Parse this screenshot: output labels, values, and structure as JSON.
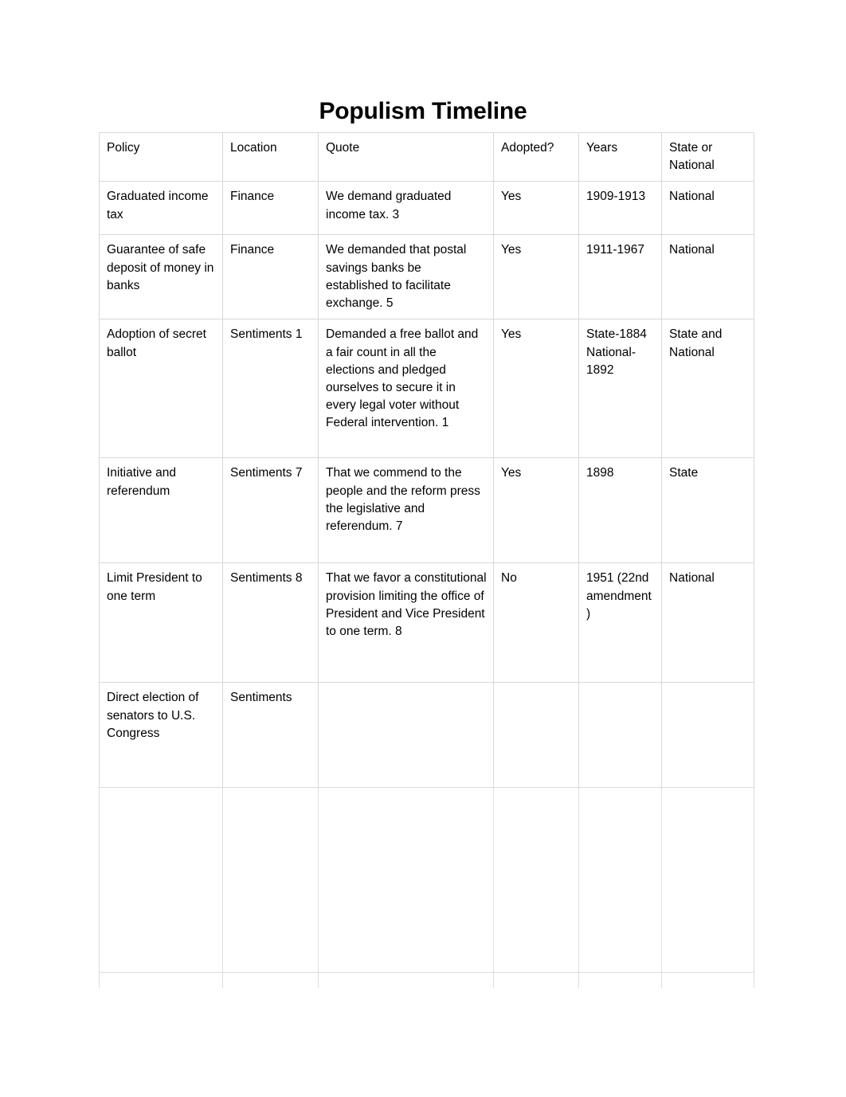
{
  "document": {
    "title": "Populism Timeline",
    "background_color": "#ffffff",
    "text_color": "#000000",
    "grid_color": "#d8d8d8"
  },
  "table": {
    "name": "populism-timeline-table",
    "columns": [
      "Policy",
      "Location",
      "Quote",
      "Adopted?",
      "Years",
      "State or National"
    ],
    "rows": [
      {
        "policy": "Graduated income tax",
        "location": "Finance",
        "quote": "We demand graduated income tax. 3",
        "adopted": "Yes",
        "years": "1909-1913",
        "scope": "National",
        "legibility": "sharp"
      },
      {
        "policy": "Guarantee of safe deposit of money in banks",
        "location": "Finance",
        "quote": "We demanded that postal savings banks be established to facilitate exchange. 5",
        "adopted": "Yes",
        "years": "1911-1967",
        "scope": "National",
        "legibility": "sharp"
      },
      {
        "policy": "Adoption of secret ballot",
        "location": "Sentiments 1",
        "quote": "Demanded a free ballot and a fair count in all the elections and pledged ourselves to secure it in every legal voter without Federal intervention. 1",
        "adopted": "Yes",
        "years": "State-1884 National-1892",
        "scope": "State and National",
        "legibility": "sharp"
      },
      {
        "policy": "Initiative and referendum",
        "location": "Sentiments 7",
        "quote": "That we commend to the people and the reform press the legislative and referendum. 7",
        "adopted": "Yes",
        "years": "1898",
        "scope": "State",
        "legibility": "sharp"
      },
      {
        "policy": "Limit President to one term",
        "location": "Sentiments 8",
        "quote": "That we favor a constitutional provision limiting the office of President and Vice President to one term. 8",
        "adopted": "No",
        "years": "1951 (22nd amendment)",
        "scope": "National",
        "legibility": "sharp"
      },
      {
        "policy": "Direct election of senators to U.S. Congress",
        "location": "Sentiments",
        "quote": "",
        "adopted": "",
        "years": "",
        "scope": "",
        "legibility": "partially-faded"
      },
      {
        "policy": "",
        "location": "",
        "quote": "",
        "adopted": "",
        "years": "",
        "scope": "",
        "legibility": "illegible"
      },
      {
        "policy": "",
        "location": "",
        "quote": "",
        "adopted": "",
        "years": "",
        "scope": "",
        "legibility": "illegible"
      }
    ]
  }
}
